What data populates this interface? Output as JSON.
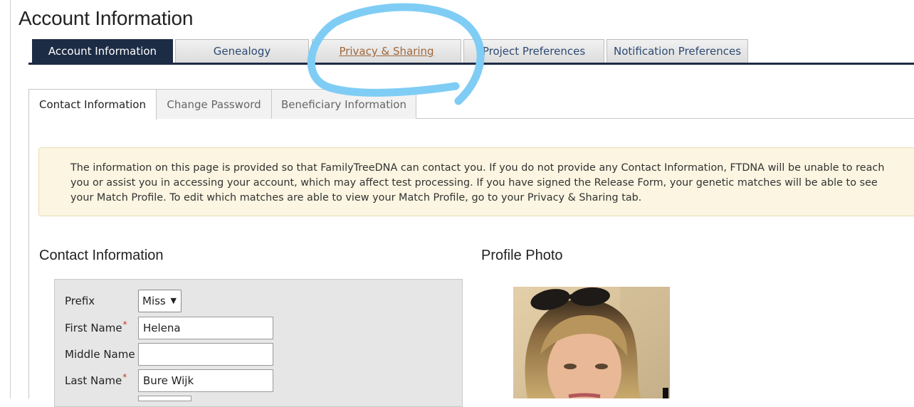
{
  "page": {
    "title": "Account Information"
  },
  "main_tabs": [
    {
      "label": "Account Information"
    },
    {
      "label": "Genealogy"
    },
    {
      "label": "Privacy & Sharing"
    },
    {
      "label": "Project Preferences"
    },
    {
      "label": "Notification Preferences"
    }
  ],
  "sub_tabs": [
    {
      "label": "Contact Information"
    },
    {
      "label": "Change Password"
    },
    {
      "label": "Beneficiary Information"
    }
  ],
  "notice": {
    "text": "The information on this page is provided so that FamilyTreeDNA can contact you. If you do not provide any Contact Information, FTDNA will be unable to reach you or assist you in accessing your account, which may affect test processing. If you have signed the Release Form, your genetic matches will be able to see your Match Profile. To edit which matches are able to view your Match Profile, go to your Privacy & Sharing tab."
  },
  "contact": {
    "heading": "Contact Information",
    "prefix": {
      "label": "Prefix",
      "value": "Miss"
    },
    "first_name": {
      "label": "First Name",
      "value": "Helena"
    },
    "middle_name": {
      "label": "Middle Name",
      "value": ""
    },
    "last_name": {
      "label": "Last Name",
      "value": "Bure Wijk"
    },
    "required_mark": "*"
  },
  "profile_photo": {
    "heading": "Profile Photo"
  },
  "colors": {
    "nav_dark": "#1d2c45",
    "tab_text": "#2c4a73",
    "link_brown": "#a0673a",
    "notice_bg": "#fbf5e1",
    "required_red": "#c0392b",
    "annotation_blue": "#7fcdf5"
  }
}
